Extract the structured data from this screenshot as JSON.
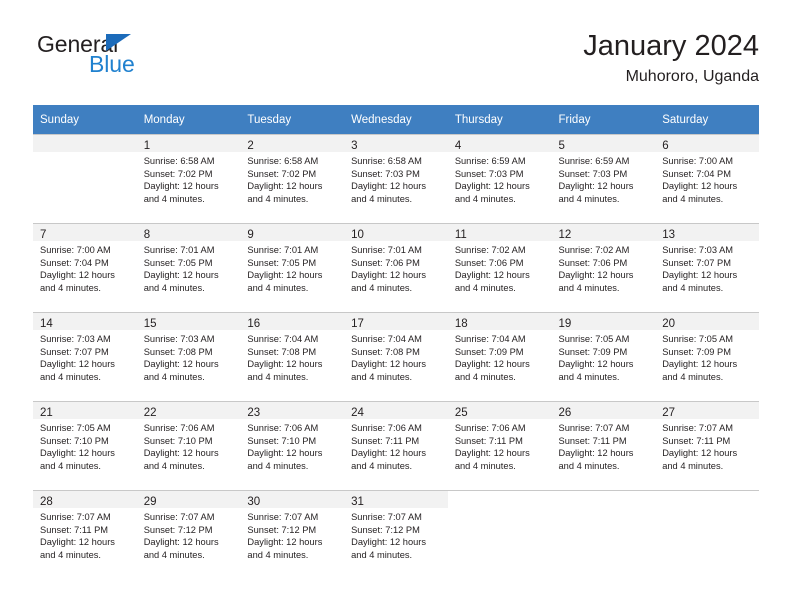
{
  "brand": {
    "name_part1": "General",
    "name_part2": "Blue",
    "color_dark": "#231f20",
    "color_blue": "#2081cf",
    "triangle_color": "#1c6bba"
  },
  "header": {
    "month_title": "January 2024",
    "location": "Muhororo, Uganda"
  },
  "calendar": {
    "header_background": "#3f7fc1",
    "weekday_headers": [
      "Sunday",
      "Monday",
      "Tuesday",
      "Wednesday",
      "Thursday",
      "Friday",
      "Saturday"
    ],
    "weeks": [
      [
        {
          "day": "",
          "sunrise": "",
          "sunset": "",
          "daylight_line1": "",
          "daylight_line2": "",
          "empty": true
        },
        {
          "day": "1",
          "sunrise": "Sunrise: 6:58 AM",
          "sunset": "Sunset: 7:02 PM",
          "daylight_line1": "Daylight: 12 hours",
          "daylight_line2": "and 4 minutes."
        },
        {
          "day": "2",
          "sunrise": "Sunrise: 6:58 AM",
          "sunset": "Sunset: 7:02 PM",
          "daylight_line1": "Daylight: 12 hours",
          "daylight_line2": "and 4 minutes."
        },
        {
          "day": "3",
          "sunrise": "Sunrise: 6:58 AM",
          "sunset": "Sunset: 7:03 PM",
          "daylight_line1": "Daylight: 12 hours",
          "daylight_line2": "and 4 minutes."
        },
        {
          "day": "4",
          "sunrise": "Sunrise: 6:59 AM",
          "sunset": "Sunset: 7:03 PM",
          "daylight_line1": "Daylight: 12 hours",
          "daylight_line2": "and 4 minutes."
        },
        {
          "day": "5",
          "sunrise": "Sunrise: 6:59 AM",
          "sunset": "Sunset: 7:03 PM",
          "daylight_line1": "Daylight: 12 hours",
          "daylight_line2": "and 4 minutes."
        },
        {
          "day": "6",
          "sunrise": "Sunrise: 7:00 AM",
          "sunset": "Sunset: 7:04 PM",
          "daylight_line1": "Daylight: 12 hours",
          "daylight_line2": "and 4 minutes."
        }
      ],
      [
        {
          "day": "7",
          "sunrise": "Sunrise: 7:00 AM",
          "sunset": "Sunset: 7:04 PM",
          "daylight_line1": "Daylight: 12 hours",
          "daylight_line2": "and 4 minutes."
        },
        {
          "day": "8",
          "sunrise": "Sunrise: 7:01 AM",
          "sunset": "Sunset: 7:05 PM",
          "daylight_line1": "Daylight: 12 hours",
          "daylight_line2": "and 4 minutes."
        },
        {
          "day": "9",
          "sunrise": "Sunrise: 7:01 AM",
          "sunset": "Sunset: 7:05 PM",
          "daylight_line1": "Daylight: 12 hours",
          "daylight_line2": "and 4 minutes."
        },
        {
          "day": "10",
          "sunrise": "Sunrise: 7:01 AM",
          "sunset": "Sunset: 7:06 PM",
          "daylight_line1": "Daylight: 12 hours",
          "daylight_line2": "and 4 minutes."
        },
        {
          "day": "11",
          "sunrise": "Sunrise: 7:02 AM",
          "sunset": "Sunset: 7:06 PM",
          "daylight_line1": "Daylight: 12 hours",
          "daylight_line2": "and 4 minutes."
        },
        {
          "day": "12",
          "sunrise": "Sunrise: 7:02 AM",
          "sunset": "Sunset: 7:06 PM",
          "daylight_line1": "Daylight: 12 hours",
          "daylight_line2": "and 4 minutes."
        },
        {
          "day": "13",
          "sunrise": "Sunrise: 7:03 AM",
          "sunset": "Sunset: 7:07 PM",
          "daylight_line1": "Daylight: 12 hours",
          "daylight_line2": "and 4 minutes."
        }
      ],
      [
        {
          "day": "14",
          "sunrise": "Sunrise: 7:03 AM",
          "sunset": "Sunset: 7:07 PM",
          "daylight_line1": "Daylight: 12 hours",
          "daylight_line2": "and 4 minutes."
        },
        {
          "day": "15",
          "sunrise": "Sunrise: 7:03 AM",
          "sunset": "Sunset: 7:08 PM",
          "daylight_line1": "Daylight: 12 hours",
          "daylight_line2": "and 4 minutes."
        },
        {
          "day": "16",
          "sunrise": "Sunrise: 7:04 AM",
          "sunset": "Sunset: 7:08 PM",
          "daylight_line1": "Daylight: 12 hours",
          "daylight_line2": "and 4 minutes."
        },
        {
          "day": "17",
          "sunrise": "Sunrise: 7:04 AM",
          "sunset": "Sunset: 7:08 PM",
          "daylight_line1": "Daylight: 12 hours",
          "daylight_line2": "and 4 minutes."
        },
        {
          "day": "18",
          "sunrise": "Sunrise: 7:04 AM",
          "sunset": "Sunset: 7:09 PM",
          "daylight_line1": "Daylight: 12 hours",
          "daylight_line2": "and 4 minutes."
        },
        {
          "day": "19",
          "sunrise": "Sunrise: 7:05 AM",
          "sunset": "Sunset: 7:09 PM",
          "daylight_line1": "Daylight: 12 hours",
          "daylight_line2": "and 4 minutes."
        },
        {
          "day": "20",
          "sunrise": "Sunrise: 7:05 AM",
          "sunset": "Sunset: 7:09 PM",
          "daylight_line1": "Daylight: 12 hours",
          "daylight_line2": "and 4 minutes."
        }
      ],
      [
        {
          "day": "21",
          "sunrise": "Sunrise: 7:05 AM",
          "sunset": "Sunset: 7:10 PM",
          "daylight_line1": "Daylight: 12 hours",
          "daylight_line2": "and 4 minutes."
        },
        {
          "day": "22",
          "sunrise": "Sunrise: 7:06 AM",
          "sunset": "Sunset: 7:10 PM",
          "daylight_line1": "Daylight: 12 hours",
          "daylight_line2": "and 4 minutes."
        },
        {
          "day": "23",
          "sunrise": "Sunrise: 7:06 AM",
          "sunset": "Sunset: 7:10 PM",
          "daylight_line1": "Daylight: 12 hours",
          "daylight_line2": "and 4 minutes."
        },
        {
          "day": "24",
          "sunrise": "Sunrise: 7:06 AM",
          "sunset": "Sunset: 7:11 PM",
          "daylight_line1": "Daylight: 12 hours",
          "daylight_line2": "and 4 minutes."
        },
        {
          "day": "25",
          "sunrise": "Sunrise: 7:06 AM",
          "sunset": "Sunset: 7:11 PM",
          "daylight_line1": "Daylight: 12 hours",
          "daylight_line2": "and 4 minutes."
        },
        {
          "day": "26",
          "sunrise": "Sunrise: 7:07 AM",
          "sunset": "Sunset: 7:11 PM",
          "daylight_line1": "Daylight: 12 hours",
          "daylight_line2": "and 4 minutes."
        },
        {
          "day": "27",
          "sunrise": "Sunrise: 7:07 AM",
          "sunset": "Sunset: 7:11 PM",
          "daylight_line1": "Daylight: 12 hours",
          "daylight_line2": "and 4 minutes."
        }
      ],
      [
        {
          "day": "28",
          "sunrise": "Sunrise: 7:07 AM",
          "sunset": "Sunset: 7:11 PM",
          "daylight_line1": "Daylight: 12 hours",
          "daylight_line2": "and 4 minutes."
        },
        {
          "day": "29",
          "sunrise": "Sunrise: 7:07 AM",
          "sunset": "Sunset: 7:12 PM",
          "daylight_line1": "Daylight: 12 hours",
          "daylight_line2": "and 4 minutes."
        },
        {
          "day": "30",
          "sunrise": "Sunrise: 7:07 AM",
          "sunset": "Sunset: 7:12 PM",
          "daylight_line1": "Daylight: 12 hours",
          "daylight_line2": "and 4 minutes."
        },
        {
          "day": "31",
          "sunrise": "Sunrise: 7:07 AM",
          "sunset": "Sunset: 7:12 PM",
          "daylight_line1": "Daylight: 12 hours",
          "daylight_line2": "and 4 minutes."
        },
        {
          "day": "",
          "sunrise": "",
          "sunset": "",
          "daylight_line1": "",
          "daylight_line2": "",
          "empty": true,
          "white": true
        },
        {
          "day": "",
          "sunrise": "",
          "sunset": "",
          "daylight_line1": "",
          "daylight_line2": "",
          "empty": true,
          "white": true
        },
        {
          "day": "",
          "sunrise": "",
          "sunset": "",
          "daylight_line1": "",
          "daylight_line2": "",
          "empty": true,
          "white": true
        }
      ]
    ]
  }
}
